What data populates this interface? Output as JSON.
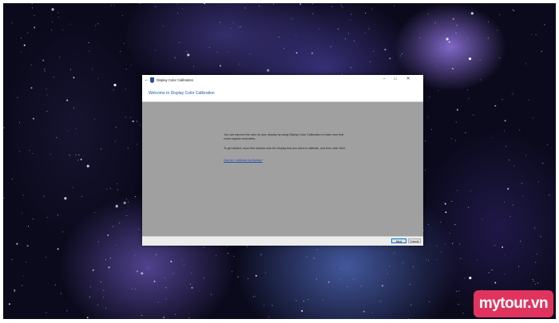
{
  "window": {
    "title": "Display Color Calibration",
    "controls": {
      "minimize": "−",
      "maximize": "□",
      "close": "✕"
    }
  },
  "header": {
    "heading": "Welcome to Display Color Calibration"
  },
  "content": {
    "paragraph1": "You can improve the color on your display by using Display Color Calibration to make sure that colors appear accurately.",
    "paragraph2": "To get started, move this window onto the display that you want to calibrate, and then click Next.",
    "help_link": "How do I calibrate my display?"
  },
  "footer": {
    "next_label": "Next",
    "cancel_label": "Cancel"
  },
  "watermark": {
    "brand": "mytour.vn"
  },
  "icons": {
    "back": "back-arrow-icon",
    "app": "color-calibration-icon"
  },
  "colors": {
    "content_background": "#a0a0a0",
    "heading": "#1a5aa8",
    "link": "#1e4fb0",
    "brand_badge": "#e0345f"
  }
}
